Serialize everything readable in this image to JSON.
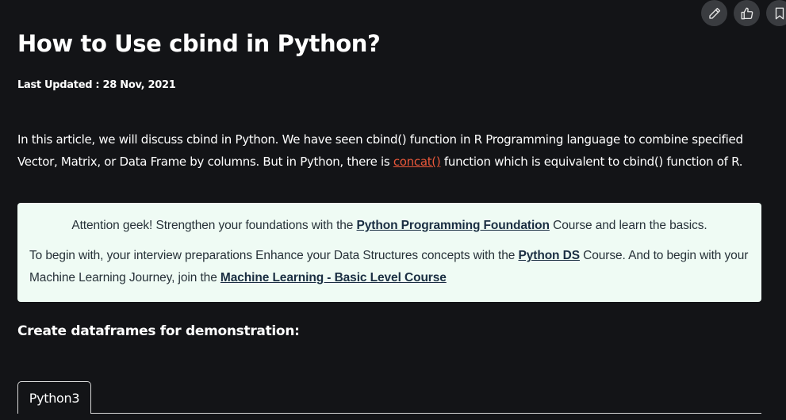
{
  "article": {
    "title": "How to Use cbind in Python?",
    "last_updated": "Last Updated : 28 Nov, 2021",
    "intro": {
      "part1": "In this article, we will discuss cbind in Python. We have seen cbind() function in R Programming language to combine specified Vector, Matrix, or Data Frame by columns. But in Python, there is ",
      "link": "concat()",
      "part2": " function which is equivalent to cbind() function of R."
    },
    "callout": {
      "line1_before": "Attention geek! Strengthen your foundations with the ",
      "line1_link": "Python Programming Foundation",
      "line1_after": " Course and learn the basics.",
      "line2_before": "To begin with, your interview preparations Enhance your Data Structures concepts with the ",
      "line2_link1": "Python DS",
      "line2_middle": " Course. And to begin with your Machine Learning Journey, join the ",
      "line2_link2": "Machine Learning - Basic Level Course"
    },
    "subheading": "Create dataframes for demonstration:",
    "code_tab": "Python3"
  },
  "actions": {
    "icons": [
      "pencil-icon",
      "thumbs-up-icon",
      "bookmark-icon"
    ]
  },
  "colors": {
    "background": "#131417",
    "link_accent": "#e8573a",
    "callout_bg": "#effbf4",
    "callout_text": "#273239"
  }
}
